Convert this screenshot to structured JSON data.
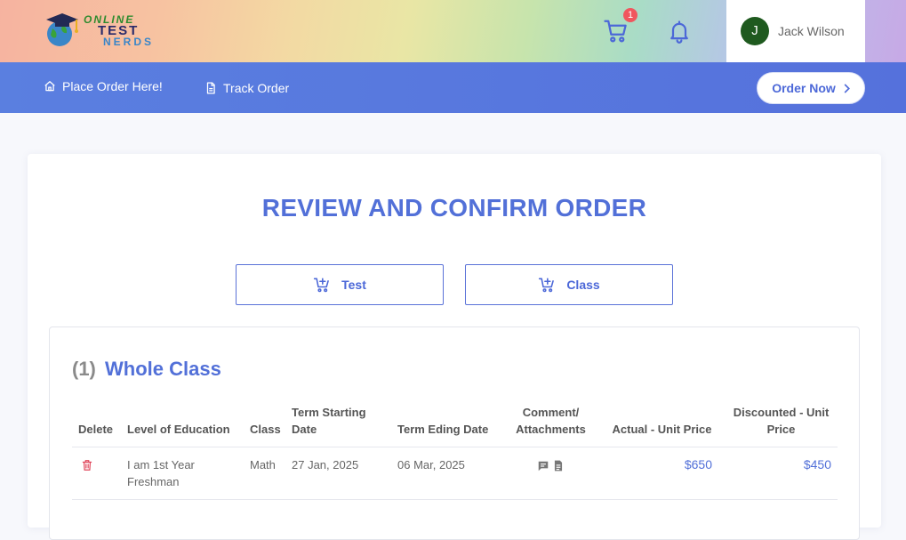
{
  "brand": {
    "line1": "ONLINE",
    "line2": "TEST",
    "line3": "NERDS"
  },
  "header": {
    "cart_count": "1",
    "user_initial": "J",
    "user_name": "Jack Wilson"
  },
  "nav": {
    "place_order": "Place Order Here!",
    "track_order": "Track Order",
    "order_now": "Order Now"
  },
  "page": {
    "title": "REVIEW AND CONFIRM ORDER",
    "tabs": [
      {
        "label": "Test"
      },
      {
        "label": "Class"
      }
    ]
  },
  "section": {
    "number": "(1)",
    "title": "Whole Class",
    "columns": {
      "delete": "Delete",
      "level": "Level of Education",
      "class": "Class",
      "term_start": "Term Starting Date",
      "term_end": "Term Eding Date",
      "comment": "Comment/ Attachments",
      "actual": "Actual - Unit Price",
      "discounted": "Discounted - Unit Price"
    },
    "rows": [
      {
        "level": "I am 1st Year Freshman",
        "class": "Math",
        "term_start": "27 Jan, 2025",
        "term_end": "06 Mar, 2025",
        "actual": "$650",
        "discounted": "$450"
      }
    ]
  },
  "icons": {
    "cart": "cart-icon",
    "bell": "bell-icon",
    "home": "home-icon",
    "document": "document-icon",
    "chevron": "chevron-right-icon",
    "add_cart": "add-to-cart-icon",
    "trash": "trash-icon",
    "comment": "comment-icon",
    "attachment": "attachment-icon"
  },
  "colors": {
    "accent": "#5270d8",
    "nav": "#5a7fe0",
    "badge": "#f0565e",
    "delete": "#e0455a",
    "avatar": "#1f5a1f"
  }
}
